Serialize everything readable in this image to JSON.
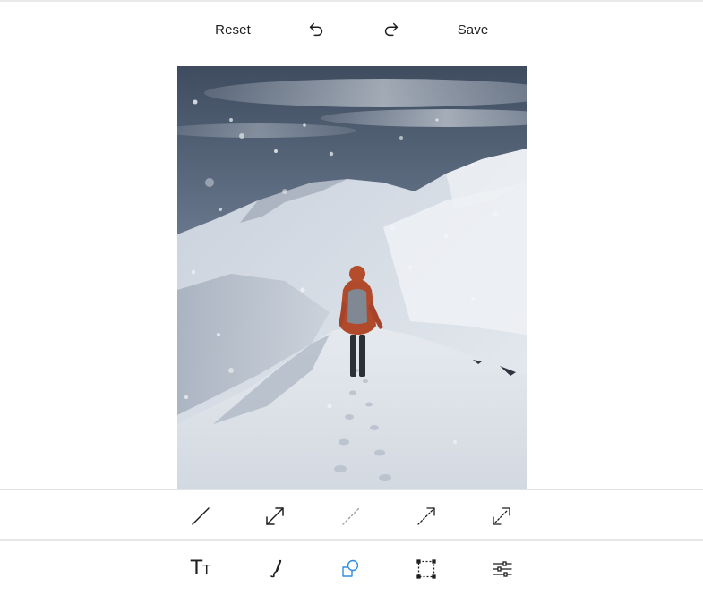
{
  "header": {
    "reset_label": "Reset",
    "save_label": "Save",
    "undo_icon": "undo-icon",
    "redo_icon": "redo-icon"
  },
  "canvas": {
    "image_subject": "snowy-mountain-hiker-photo"
  },
  "shape_options": [
    {
      "icon": "line-icon"
    },
    {
      "icon": "double-arrow-icon"
    },
    {
      "icon": "dashed-line-icon"
    },
    {
      "icon": "arrow-icon"
    },
    {
      "icon": "dashed-double-arrow-icon"
    }
  ],
  "tools": [
    {
      "icon": "text-tool-icon",
      "glyph_big": "T",
      "glyph_small": "T"
    },
    {
      "icon": "draw-brush-icon"
    },
    {
      "icon": "shapes-icon",
      "active": true
    },
    {
      "icon": "crop-frame-icon"
    },
    {
      "icon": "adjust-sliders-icon"
    }
  ],
  "colors": {
    "accent": "#2f8ee0",
    "icon": "#1f1f1f",
    "dashed_icon": "#9aa3ad",
    "divider": "#e3e3e3"
  }
}
